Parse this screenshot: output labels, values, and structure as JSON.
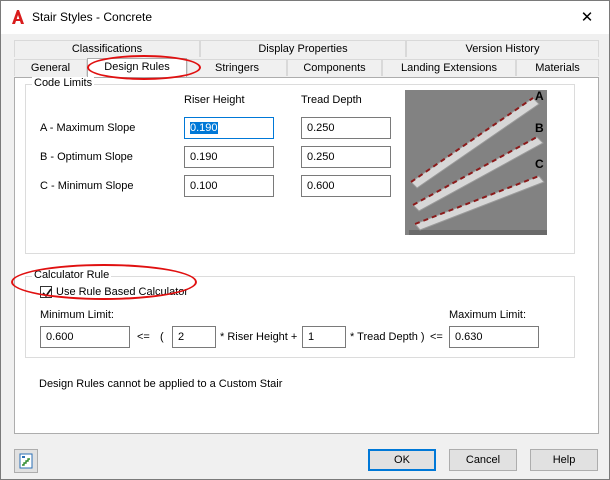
{
  "window": {
    "title": "Stair Styles - Concrete",
    "close_glyph": "✕"
  },
  "tabs_top": [
    {
      "label": "Classifications"
    },
    {
      "label": "Display Properties"
    },
    {
      "label": "Version History"
    }
  ],
  "tabs_bottom": [
    {
      "label": "General"
    },
    {
      "label": "Design Rules"
    },
    {
      "label": "Stringers"
    },
    {
      "label": "Components"
    },
    {
      "label": "Landing Extensions"
    },
    {
      "label": "Materials"
    }
  ],
  "selected_tab": "Design Rules",
  "code_limits": {
    "legend": "Code Limits",
    "col_riser": "Riser Height",
    "col_tread": "Tread Depth",
    "rows": [
      {
        "label": "A - Maximum Slope",
        "riser": "0.190",
        "tread": "0.250"
      },
      {
        "label": "B - Optimum Slope",
        "riser": "0.190",
        "tread": "0.250"
      },
      {
        "label": "C - Minimum Slope",
        "riser": "0.100",
        "tread": "0.600"
      }
    ],
    "image_labels": {
      "a": "A",
      "b": "B",
      "c": "C"
    }
  },
  "calculator": {
    "legend": "Calculator Rule",
    "checkbox_label": "Use Rule Based Calculator",
    "checked": true,
    "min_label": "Minimum Limit:",
    "max_label": "Maximum Limit:",
    "min_value": "0.600",
    "op1": "<=",
    "paren": "(",
    "riser_mult": "2",
    "riser_text": "* Riser Height +",
    "tread_mult": "1",
    "tread_text": "* Tread Depth )",
    "op2": "<=",
    "max_value": "0.630"
  },
  "note": "Design Rules cannot be applied to a Custom Stair",
  "buttons": {
    "ok": "OK",
    "cancel": "Cancel",
    "help": "Help"
  },
  "icons": {
    "app": "autocad-a-icon",
    "bottom_left": "stair-style-icon"
  },
  "colors": {
    "accent": "#0078d7",
    "highlight": "#e01010",
    "app_icon": "#d91c1c"
  }
}
